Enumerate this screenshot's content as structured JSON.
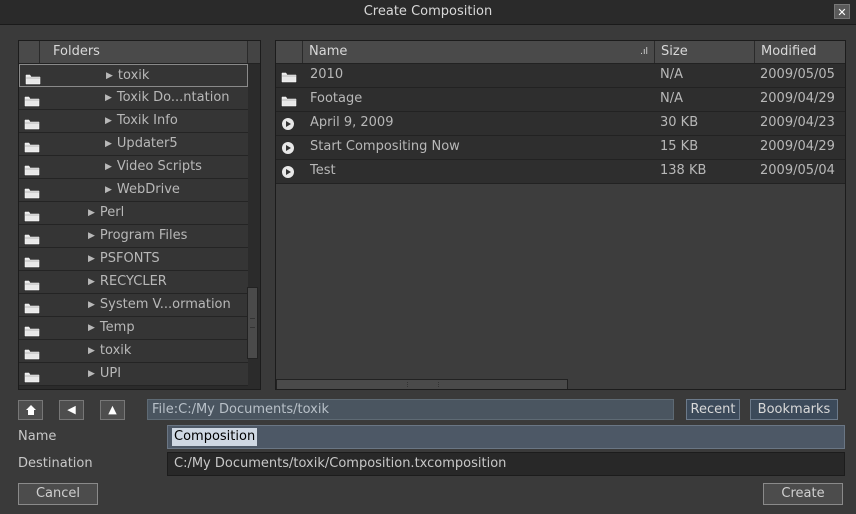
{
  "window": {
    "title": "Create Composition",
    "close_glyph": "✕"
  },
  "folders": {
    "header": "Folders",
    "items": [
      {
        "label": "toxik",
        "indent": 2
      },
      {
        "label": "Toxik Do...ntation",
        "indent": 2
      },
      {
        "label": "Toxik Info",
        "indent": 2
      },
      {
        "label": "Updater5",
        "indent": 2
      },
      {
        "label": "Video Scripts",
        "indent": 2
      },
      {
        "label": "WebDrive",
        "indent": 2
      },
      {
        "label": "Perl",
        "indent": 1
      },
      {
        "label": "Program Files",
        "indent": 1
      },
      {
        "label": "PSFONTS",
        "indent": 1
      },
      {
        "label": "RECYCLER",
        "indent": 1
      },
      {
        "label": "System V...ormation",
        "indent": 1
      },
      {
        "label": "Temp",
        "indent": 1
      },
      {
        "label": "toxik",
        "indent": 1
      },
      {
        "label": "UPI",
        "indent": 1
      }
    ]
  },
  "files": {
    "columns": {
      "name": "Name",
      "size": "Size",
      "modified": "Modified"
    },
    "rows": [
      {
        "icon": "folder-icon",
        "name": "2010",
        "size": "N/A",
        "modified": "2009/05/05"
      },
      {
        "icon": "folder-icon",
        "name": "Footage",
        "size": "N/A",
        "modified": "2009/04/29"
      },
      {
        "icon": "composition-icon",
        "name": "April 9, 2009",
        "size": "30 KB",
        "modified": "2009/04/23"
      },
      {
        "icon": "composition-icon",
        "name": "Start Compositing Now",
        "size": "15 KB",
        "modified": "2009/04/29"
      },
      {
        "icon": "composition-icon",
        "name": "Test",
        "size": "138 KB",
        "modified": "2009/05/04"
      }
    ]
  },
  "nav": {
    "home_glyph": "🏠",
    "back_glyph": "◀",
    "up_glyph": "▲",
    "path": "File:C:/My Documents/toxik",
    "recent": "Recent",
    "bookmarks": "Bookmarks"
  },
  "form": {
    "name_label": "Name",
    "name_value": "Composition",
    "destination_label": "Destination",
    "destination_value": "C:/My Documents/toxik/Composition.txcomposition"
  },
  "buttons": {
    "cancel": "Cancel",
    "create": "Create"
  },
  "colors": {
    "background": "#3a3a3a",
    "selection": "#cfd8e3",
    "path_bar": "#4a5560"
  }
}
